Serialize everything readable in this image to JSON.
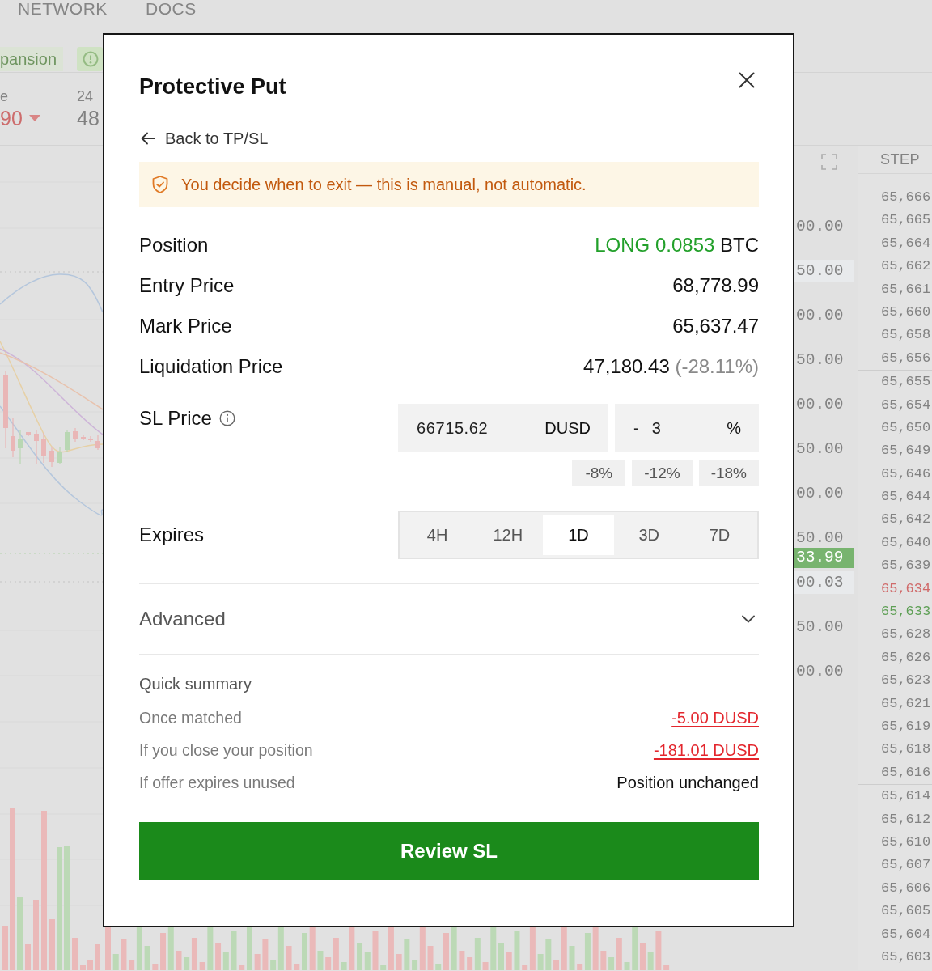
{
  "background": {
    "nav": [
      "NETWORK",
      "DOCS"
    ],
    "tag": "pansion",
    "stats": [
      {
        "label": "e",
        "value": "90",
        "falling": true
      },
      {
        "label": "24",
        "value": "48",
        "falling": false
      }
    ],
    "price_axis": {
      "labels": [
        {
          "text": "00.00",
          "boxed": false
        },
        {
          "text": "50.00",
          "boxed": true
        },
        {
          "text": "00.00",
          "boxed": false
        },
        {
          "text": "50.00",
          "boxed": false
        },
        {
          "text": "00.00",
          "boxed": false
        },
        {
          "text": "50.00",
          "boxed": false
        },
        {
          "text": "00.00",
          "boxed": false
        },
        {
          "text": "50.00",
          "boxed": false
        },
        {
          "text": "00.03",
          "boxed": true
        },
        {
          "text": "50.00",
          "boxed": false
        },
        {
          "text": "00.00",
          "boxed": false
        }
      ],
      "current_price": "33.99"
    },
    "order_book": {
      "header": "STEP",
      "sections": [
        {
          "rows": [
            {
              "price": "65,666",
              "color": "#828282"
            },
            {
              "price": "65,665",
              "color": "#828282"
            },
            {
              "price": "65,664",
              "color": "#828282"
            },
            {
              "price": "65,662",
              "color": "#828282"
            },
            {
              "price": "65,661",
              "color": "#828282"
            },
            {
              "price": "65,660",
              "color": "#828282"
            },
            {
              "price": "65,658",
              "color": "#828282"
            },
            {
              "price": "65,656",
              "color": "#828282"
            }
          ]
        },
        {
          "rows": [
            {
              "price": "65,655",
              "color": "#828282"
            },
            {
              "price": "65,654",
              "color": "#828282"
            },
            {
              "price": "65,650",
              "color": "#828282"
            },
            {
              "price": "65,649",
              "color": "#828282"
            },
            {
              "price": "65,646",
              "color": "#828282"
            },
            {
              "price": "65,644",
              "color": "#828282"
            },
            {
              "price": "65,642",
              "color": "#828282"
            },
            {
              "price": "65,640",
              "color": "#828282"
            },
            {
              "price": "65,639",
              "color": "#828282"
            },
            {
              "price": "65,634",
              "color": "#d06a6a"
            },
            {
              "price": "65,633",
              "color": "#5e9f55"
            },
            {
              "price": "65,628",
              "color": "#828282"
            },
            {
              "price": "65,626",
              "color": "#828282"
            },
            {
              "price": "65,623",
              "color": "#828282"
            },
            {
              "price": "65,621",
              "color": "#828282"
            },
            {
              "price": "65,619",
              "color": "#828282"
            },
            {
              "price": "65,618",
              "color": "#828282"
            },
            {
              "price": "65,616",
              "color": "#828282"
            }
          ]
        },
        {
          "rows": [
            {
              "price": "65,614",
              "color": "#828282"
            },
            {
              "price": "65,612",
              "color": "#828282"
            },
            {
              "price": "65,610",
              "color": "#828282"
            },
            {
              "price": "65,607",
              "color": "#828282"
            },
            {
              "price": "65,606",
              "color": "#828282"
            },
            {
              "price": "65,605",
              "color": "#828282"
            },
            {
              "price": "65,604",
              "color": "#828282"
            },
            {
              "price": "65,603",
              "color": "#828282"
            }
          ]
        }
      ]
    }
  },
  "modal": {
    "title": "Protective Put",
    "back_link": "Back to TP/SL",
    "notice": "You decide when to exit — this is manual, not automatic.",
    "details": [
      {
        "label": "Position",
        "value": "LONG 0.0853",
        "unit": "BTC",
        "positive": true
      },
      {
        "label": "Entry Price",
        "value": "68,778.99",
        "positive": false
      },
      {
        "label": "Mark Price",
        "value": "65,637.47",
        "positive": false
      },
      {
        "label": "Liquidation Price",
        "value": "47,180.43",
        "note": "(-28.11%)",
        "positive": false
      }
    ],
    "sl_price": {
      "label": "SL Price",
      "price": {
        "value": "66715.62",
        "unit": "DUSD"
      },
      "offset": {
        "sign": "-",
        "value": "3",
        "unit": "%"
      },
      "presets": [
        "-8%",
        "-12%",
        "-18%"
      ]
    },
    "expires": {
      "label": "Expires",
      "options": [
        {
          "label": "4H",
          "selected": false
        },
        {
          "label": "12H",
          "selected": false
        },
        {
          "label": "1D",
          "selected": true
        },
        {
          "label": "3D",
          "selected": false
        },
        {
          "label": "7D",
          "selected": false
        }
      ]
    },
    "advanced": {
      "label": "Advanced",
      "expanded": false
    },
    "summary": {
      "title": "Quick summary",
      "rows": [
        {
          "label": "Once matched",
          "value": "-5.00 DUSD",
          "negative": true
        },
        {
          "label": "If you close your position",
          "value": "-181.01 DUSD",
          "negative": true
        },
        {
          "label": "If offer expires unused",
          "value": "Position unchanged",
          "negative": false
        }
      ]
    },
    "submit": "Review SL"
  }
}
